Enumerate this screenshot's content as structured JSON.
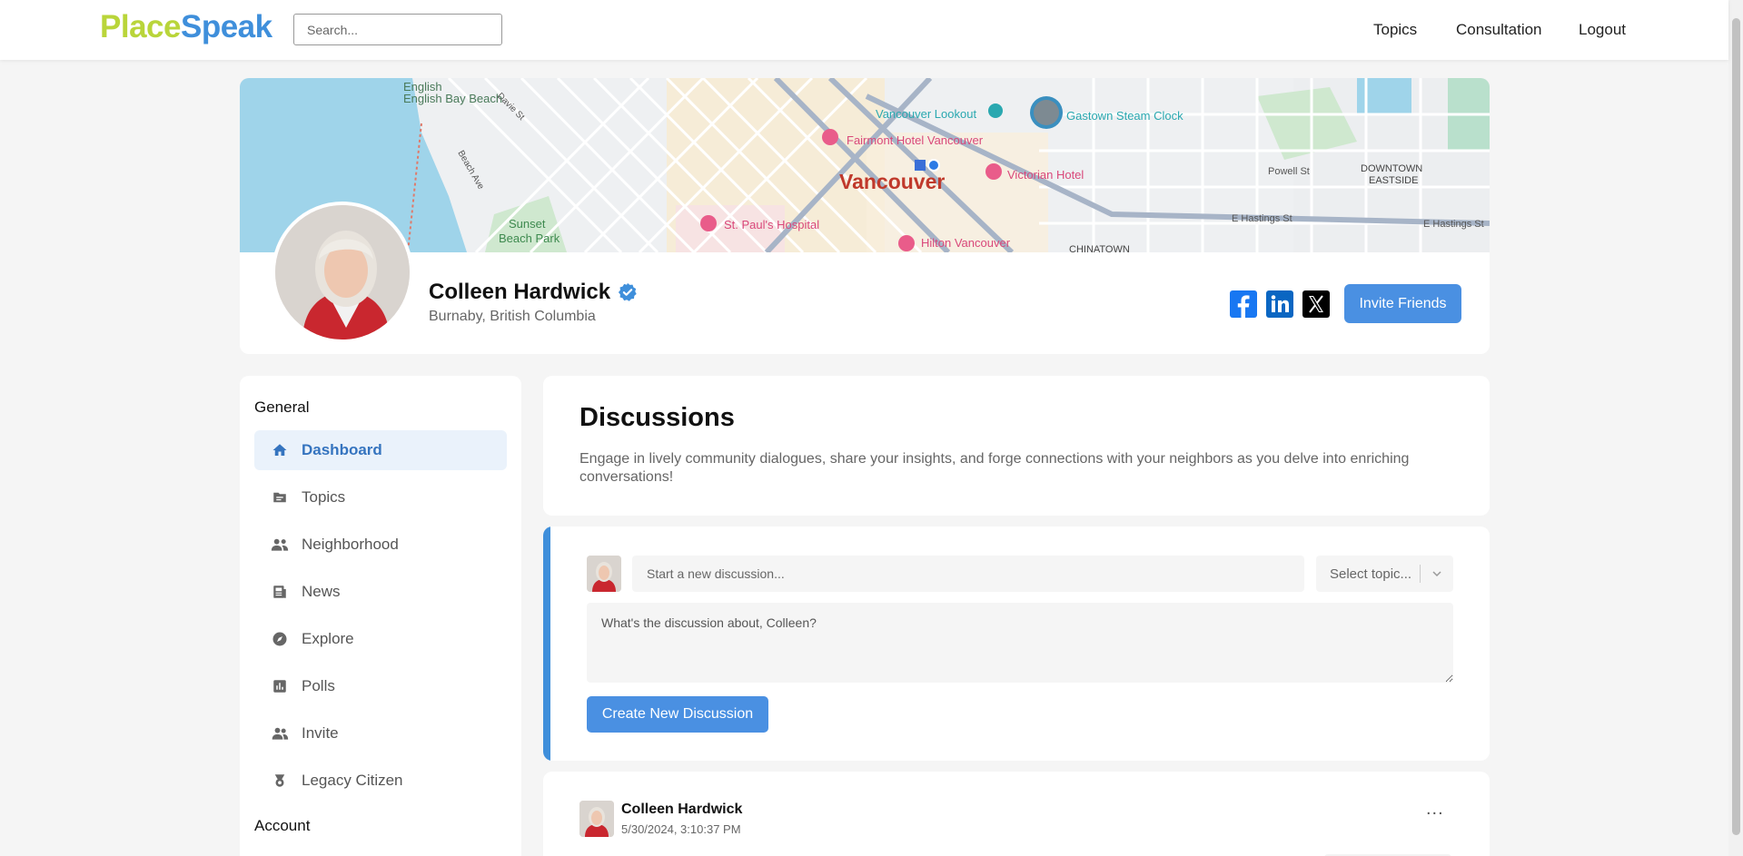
{
  "header": {
    "logo_part1": "Place",
    "logo_part2": "Speak",
    "search_placeholder": "Search...",
    "nav": [
      "Topics",
      "Consultation",
      "Logout"
    ]
  },
  "profile": {
    "name": "Colleen Hardwick",
    "location": "Burnaby, British Columbia",
    "invite_label": "Invite Friends",
    "social": [
      "facebook",
      "linkedin",
      "x"
    ],
    "map_labels": {
      "city": "Vancouver",
      "places": [
        "English Bay Beach",
        "Vancouver Lookout",
        "Gastown Steam Clock",
        "Fairmont Hotel Vancouver",
        "Victorian Hotel",
        "St. Paul's Hospital",
        "Hilton Vancouver",
        "Sunset Beach Park",
        "Powell St",
        "DOWNTOWN",
        "EASTSIDE",
        "E Hastings St",
        "E Hastings St",
        "CHINATOWN",
        "Davie St",
        "Beach Ave"
      ]
    }
  },
  "sidebar": {
    "general_heading": "General",
    "account_heading": "Account",
    "items": [
      {
        "label": "Dashboard",
        "icon": "home-icon"
      },
      {
        "label": "Topics",
        "icon": "folder-icon"
      },
      {
        "label": "Neighborhood",
        "icon": "people-icon"
      },
      {
        "label": "News",
        "icon": "newspaper-icon"
      },
      {
        "label": "Explore",
        "icon": "compass-icon"
      },
      {
        "label": "Polls",
        "icon": "poll-icon"
      },
      {
        "label": "Invite",
        "icon": "invite-icon"
      },
      {
        "label": "Legacy Citizen",
        "icon": "badge-icon"
      }
    ]
  },
  "discussions": {
    "title": "Discussions",
    "description": "Engage in lively community dialogues, share your insights, and forge connections with your neighbors as you delve into enriching conversations!"
  },
  "new_discussion": {
    "title_placeholder": "Start a new discussion...",
    "topic_select": "Select topic...",
    "body_placeholder": "What's the discussion about, Colleen?",
    "create_label": "Create New Discussion"
  },
  "post": {
    "author": "Colleen Hardwick",
    "timestamp": "5/30/2024, 3:10:37 PM",
    "menu": "..."
  },
  "colors": {
    "accent": "#4a90e2",
    "logo_green": "#b9d53a",
    "logo_blue": "#3f8fdb"
  }
}
